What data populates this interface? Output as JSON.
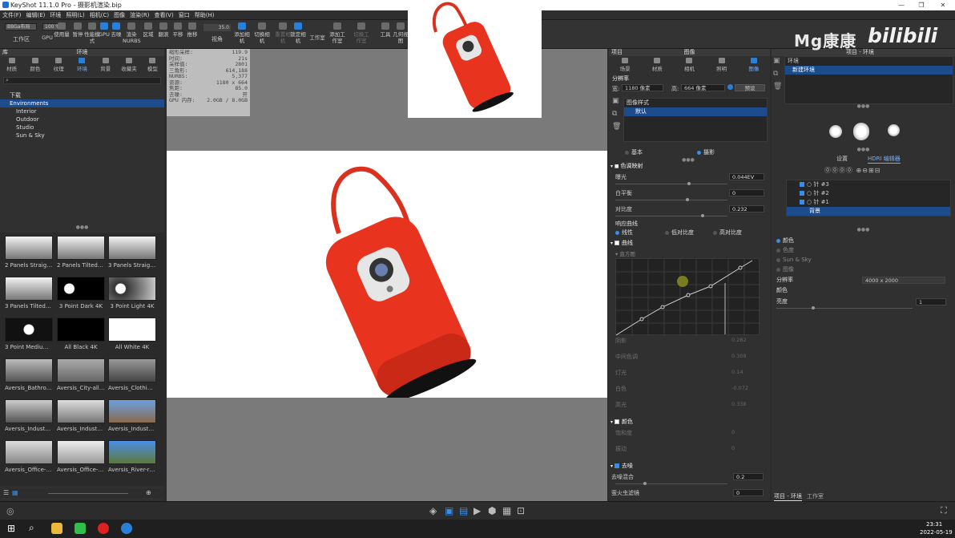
{
  "window": {
    "title": "KeyShot 11.1.0 Pro - 摄影机渲染.bip"
  },
  "menu": [
    "文件(F)",
    "编辑(E)",
    "环境",
    "照明(L)",
    "相机(C)",
    "图像",
    "渲染(R)",
    "查看(V)",
    "窗口",
    "帮助(H)"
  ],
  "toolbar": {
    "workspace_select": "BBGa布局",
    "zoom": "100 %",
    "workspace_label": "工作区",
    "cpu_gpu": "GPU",
    "usage": "使用量",
    "pause": "暂停",
    "perf_mode": "性能模式",
    "gpu_btn": "GPU",
    "denoise": "去噪",
    "nurbs": "渲染NURBS",
    "region": "区域",
    "flip": "翻滚",
    "pan": "平移",
    "dolly": "推移",
    "fov": "视角",
    "fov_value": "35.0",
    "add_camera": "添加相机",
    "switch_camera": "切换相机",
    "reset_camera": "重置相机",
    "lock_camera": "锁定相机",
    "studio": "工作室",
    "add_studio": "添加工作室",
    "switch_studio": "切换工作室",
    "tools": "工具",
    "geometry_view": "几何视图"
  },
  "library": {
    "header": "库",
    "subheader": "环境",
    "tabs": [
      "材质",
      "颜色",
      "纹理",
      "环境",
      "背景",
      "收藏夹",
      "模型"
    ],
    "active_tab": "环境",
    "tree": [
      "下载",
      "Environments",
      "Interior",
      "Outdoor",
      "Studio",
      "Sun & Sky"
    ],
    "thumbs": [
      "2 Panels Straight...",
      "2 Panels Tilted 4K",
      "3 Panels Straight...",
      "3 Panels Tilted 4K",
      "3 Point Dark 4K",
      "3 Point Light 4K",
      "3 Point Medium ...",
      "All Black 4K",
      "All White 4K",
      "Aversis_Bathroo...",
      "Aversis_City-alle...",
      "Aversis_Clothing...",
      "Aversis_Industria...",
      "Aversis_Industria...",
      "Aversis_Industria...",
      "Aversis_Office-h...",
      "Aversis_Office-h...",
      "Aversis_River-ro..."
    ]
  },
  "stats": [
    [
      "缩形采样:",
      "119.9"
    ],
    [
      "时间:",
      "21s"
    ],
    [
      "采样值:",
      "2801"
    ],
    [
      "三角形:",
      "614,188"
    ],
    [
      "NURBS:",
      "5,377"
    ],
    [
      "资源:",
      "1180 x 664"
    ],
    [
      "焦距:",
      "85.0"
    ],
    [
      "去噪:",
      "开"
    ],
    [
      "GPU 内存:",
      "2.0GB / 8.0GB"
    ]
  ],
  "image_panel": {
    "header_left": "项目",
    "header": "图像",
    "tabs": [
      "场景",
      "材质",
      "相机",
      "照明",
      "图像"
    ],
    "active_tab": "图像",
    "resolution_label": "分辨率",
    "width_label": "宽:",
    "width": "1180 像素",
    "height_label": "高:",
    "height": "664 像素",
    "preset": "预设",
    "image_style_label": "图像样式",
    "image_style_item": "默认",
    "mode_basic": "基本",
    "mode_photo": "摄影",
    "tonemap": "色调映射",
    "exposure": "曝光",
    "exposure_val": "0.044EV",
    "whitepoint": "白平衡",
    "whitepoint_val": "0",
    "contrast": "对比度",
    "contrast_val": "0.232",
    "response_curve": "响应曲线",
    "rc_linear": "线性",
    "rc_low": "低对比度",
    "rc_high": "高对比度",
    "curve": "曲线",
    "histogram": "直方图",
    "curve_params": [
      [
        "阴影",
        "0.282"
      ],
      [
        "中间色调",
        "0.308"
      ],
      [
        "灯光",
        "0.14"
      ],
      [
        "白色",
        "-0.072"
      ],
      [
        "高光",
        "0.338"
      ]
    ],
    "color": "颜色",
    "saturation": "饱和度",
    "saturation_val": "0",
    "vibrance": "振动",
    "vibrance_val": "0",
    "denoise": "去噪",
    "denoise_blend": "去噪混合",
    "denoise_blend_val": "0.2",
    "firefly": "萤火虫滤镜",
    "firefly_val": "0"
  },
  "env_panel": {
    "header": "项目 - 环境",
    "list": [
      "环境",
      "新建环境"
    ],
    "sub_tabs": [
      "设置",
      "HDRI 编辑器"
    ],
    "pins": [
      "针 #3",
      "针 #2",
      "针 #1",
      "背景"
    ],
    "bg_opts": [
      "颜色",
      "色度",
      "Sun & Sky",
      "图像"
    ],
    "resolution_label": "分辨率",
    "resolution_val": "4000 x 2000",
    "color_label": "颜色",
    "brightness_label": "亮度",
    "brightness_val": "1",
    "bottom_tabs": [
      "项目 - 环境",
      "工作室"
    ]
  },
  "watermark": {
    "text": "Mg康康",
    "logo": "bilibili"
  },
  "tray": {
    "time": "23:31",
    "date": "2022-05-19"
  },
  "colors": {
    "accent": "#2a7fd6",
    "product_red": "#e8341f"
  }
}
